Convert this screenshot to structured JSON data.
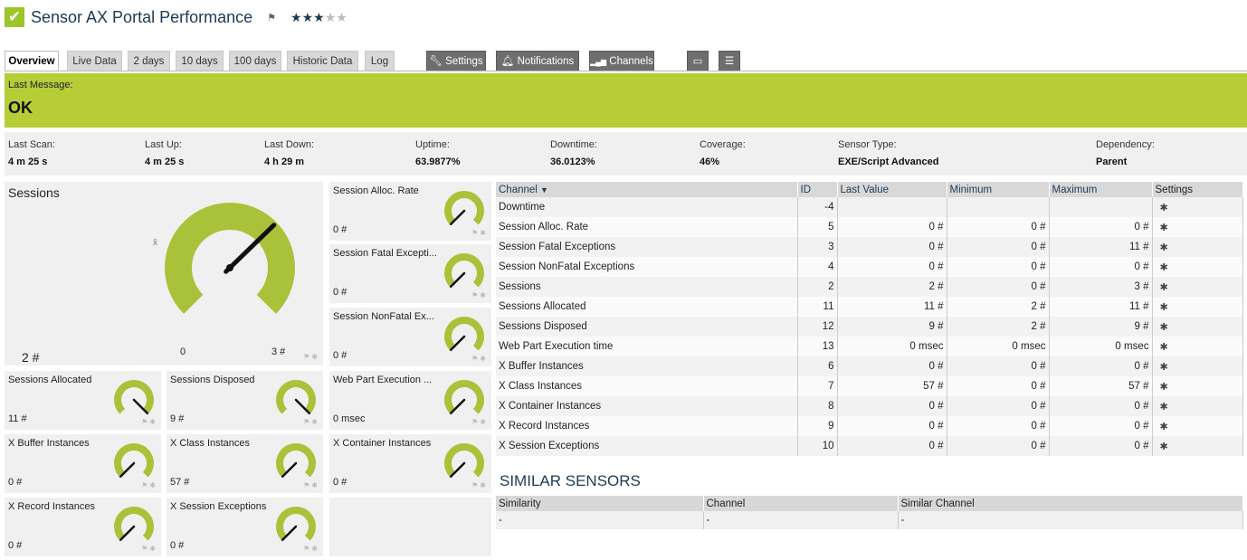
{
  "header": {
    "status_icon": "check-icon",
    "title": "Sensor AX Portal Performance",
    "flag": "⚑",
    "rating": {
      "value": 3,
      "max": 5
    }
  },
  "tabs": [
    {
      "label": "Overview",
      "active": true
    },
    {
      "label": "Live Data"
    },
    {
      "label": "2 days"
    },
    {
      "label": "10 days"
    },
    {
      "label": "100 days"
    },
    {
      "label": "Historic Data"
    },
    {
      "label": "Log"
    },
    {
      "label": "Settings",
      "icon": "wrench-icon",
      "dark": true
    },
    {
      "label": "Notifications",
      "icon": "bell-icon",
      "dark": true
    },
    {
      "label": "Channels",
      "icon": "bars-icon",
      "dark": true
    },
    {
      "label": "",
      "icon": "comment-icon",
      "dark": true
    },
    {
      "label": "",
      "icon": "list-icon",
      "dark": true
    }
  ],
  "message": {
    "label": "Last Message:",
    "value": "OK",
    "color": "#b6cd38"
  },
  "info": [
    {
      "label": "Last Scan:",
      "value": "4 m 25 s"
    },
    {
      "label": "Last Up:",
      "value": "4 m 25 s"
    },
    {
      "label": "Last Down:",
      "value": "4 h 29 m"
    },
    {
      "label": "Uptime:",
      "value": "63.9877%"
    },
    {
      "label": "Downtime:",
      "value": "36.0123%"
    },
    {
      "label": "Coverage:",
      "value": "46%"
    },
    {
      "label": "Sensor Type:",
      "value": "EXE/Script Advanced"
    },
    {
      "label": "Dependency:",
      "value": "Parent"
    }
  ],
  "main_gauge": {
    "name": "Sessions",
    "value": "2 #",
    "min_label": "0",
    "max_label": "3 #",
    "avg_mark": "x̄",
    "level": 0.67
  },
  "gauges": [
    {
      "name": "Session Alloc. Rate",
      "value": "0 #",
      "level": 0.0
    },
    {
      "name": "Session Fatal Excepti...",
      "value": "0 #",
      "level": 0.0
    },
    {
      "name": "Session NonFatal Ex...",
      "value": "0 #",
      "level": 0.0
    },
    {
      "name": "Sessions Allocated",
      "value": "11 #",
      "level": 1.0
    },
    {
      "name": "Sessions Disposed",
      "value": "9 #",
      "level": 1.0
    },
    {
      "name": "Web Part Execution ...",
      "value": "0 msec",
      "level": 0.0
    },
    {
      "name": "X Buffer Instances",
      "value": "0 #",
      "level": 0.0
    },
    {
      "name": "X Class Instances",
      "value": "57 #",
      "level": 0.0
    },
    {
      "name": "X Container Instances",
      "value": "0 #",
      "level": 0.0
    },
    {
      "name": "X Record Instances",
      "value": "0 #",
      "level": 0.0
    },
    {
      "name": "X Session Exceptions",
      "value": "0 #",
      "level": 0.0
    }
  ],
  "channel_table": {
    "headers": [
      "Channel",
      "ID",
      "Last Value",
      "Minimum",
      "Maximum",
      "Settings"
    ],
    "rows": [
      [
        "Downtime",
        "-4",
        "",
        "",
        ""
      ],
      [
        "Session Alloc. Rate",
        "5",
        "0 #",
        "0 #",
        "0 #"
      ],
      [
        "Session Fatal Exceptions",
        "3",
        "0 #",
        "0 #",
        "11 #"
      ],
      [
        "Session NonFatal Exceptions",
        "4",
        "0 #",
        "0 #",
        "0 #"
      ],
      [
        "Sessions",
        "2",
        "2 #",
        "0 #",
        "3 #"
      ],
      [
        "Sessions Allocated",
        "11",
        "11 #",
        "2 #",
        "11 #"
      ],
      [
        "Sessions Disposed",
        "12",
        "9 #",
        "2 #",
        "9 #"
      ],
      [
        "Web Part Execution time",
        "13",
        "0 msec",
        "0 msec",
        "0 msec"
      ],
      [
        "X Buffer Instances",
        "6",
        "0 #",
        "0 #",
        "0 #"
      ],
      [
        "X Class Instances",
        "7",
        "57 #",
        "0 #",
        "57 #"
      ],
      [
        "X Container Instances",
        "8",
        "0 #",
        "0 #",
        "0 #"
      ],
      [
        "X Record Instances",
        "9",
        "0 #",
        "0 #",
        "0 #"
      ],
      [
        "X Session Exceptions",
        "10",
        "0 #",
        "0 #",
        "0 #"
      ]
    ]
  },
  "similar": {
    "title": "SIMILAR SENSORS",
    "headers": [
      "Similarity",
      "Channel",
      "Similar Channel"
    ],
    "row": [
      "-",
      "-",
      "-"
    ]
  },
  "colors": {
    "accent": "#b6cd38",
    "gauge": "#a9c23a",
    "title": "#1d3a55"
  }
}
